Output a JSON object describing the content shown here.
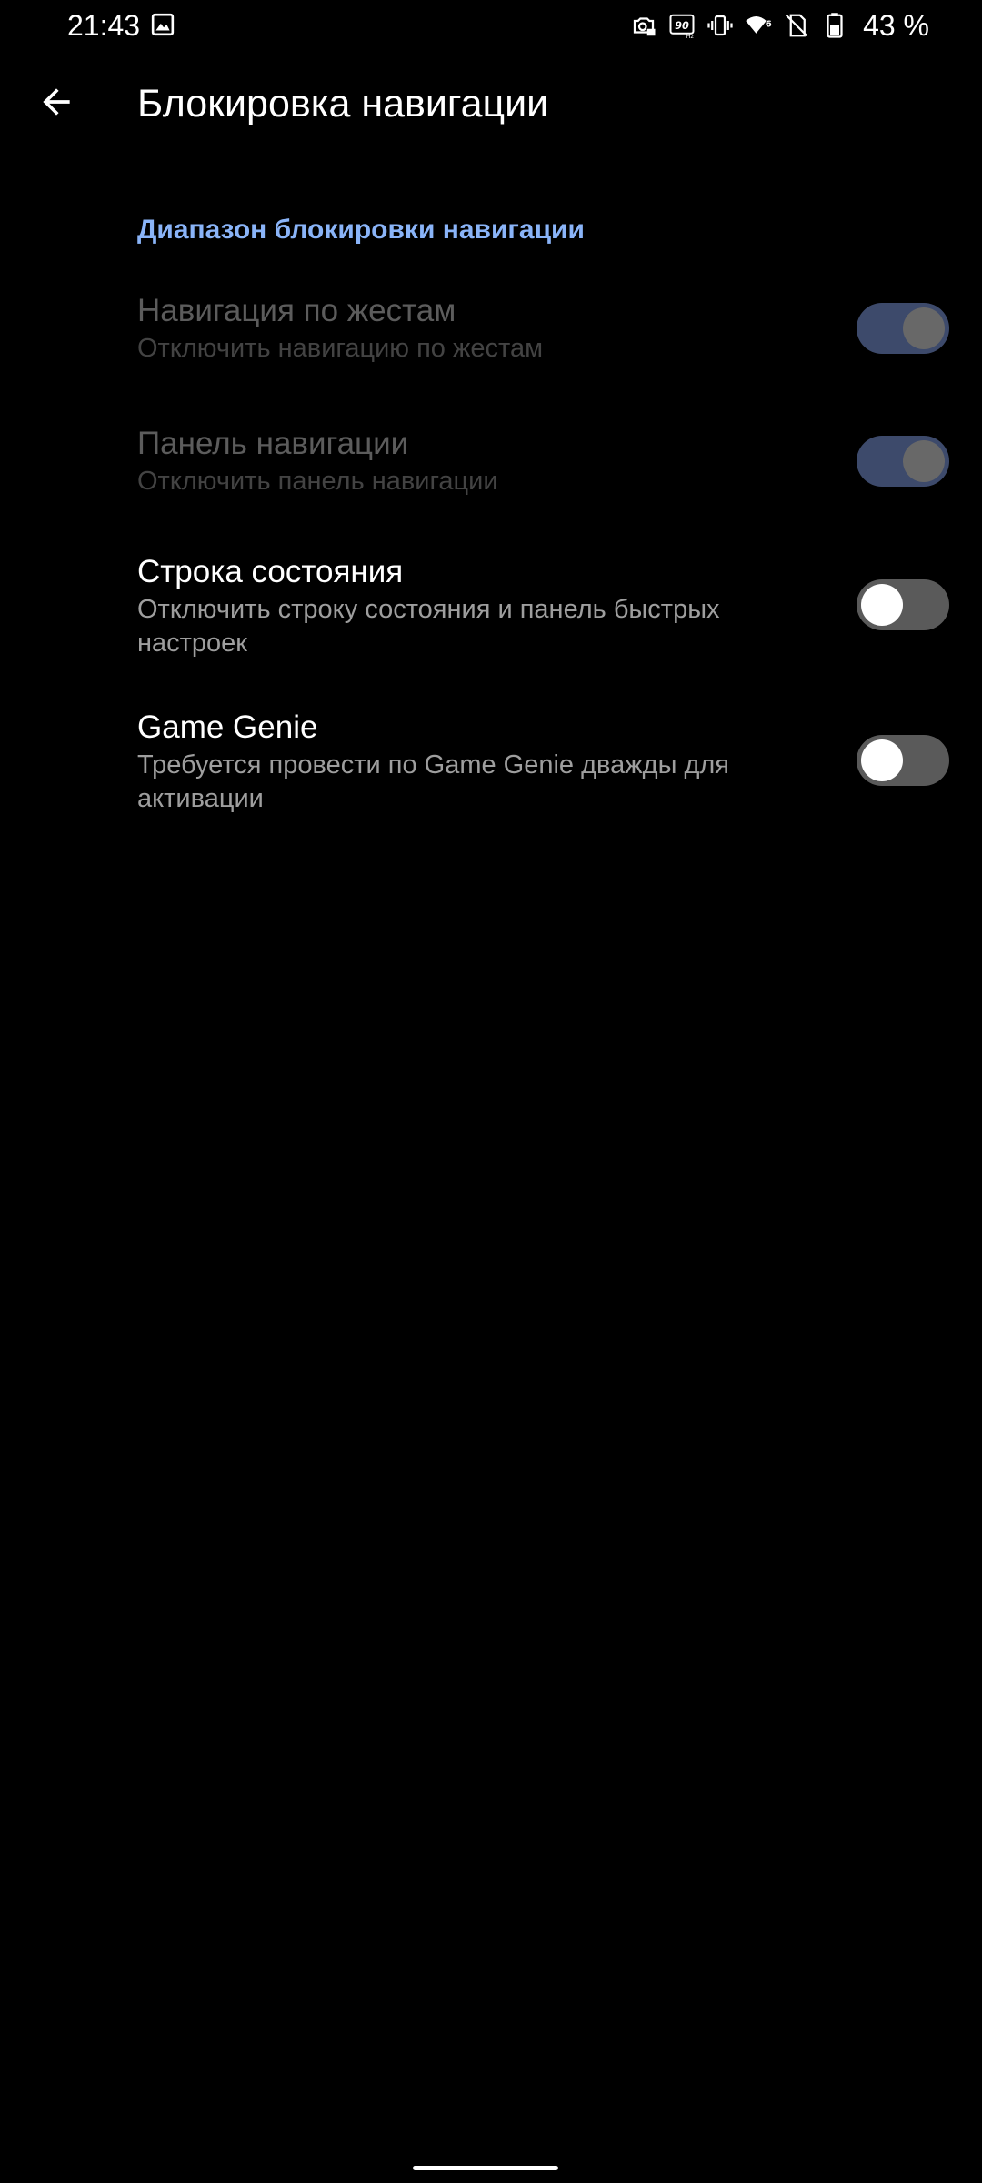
{
  "status_bar": {
    "time": "21:43",
    "battery_text": "43 %",
    "icons": [
      "gallery-icon",
      "screenshot-lock-icon",
      "refresh-rate-90hz-icon",
      "vibrate-icon",
      "wifi-6-icon",
      "no-sim-icon",
      "battery-icon"
    ]
  },
  "app_bar": {
    "back_icon": "arrow-back-icon",
    "title": "Блокировка навигации"
  },
  "section": {
    "header": "Диапазон блокировки навигации"
  },
  "settings": [
    {
      "title": "Навигация по жестам",
      "summary": "Отключить навигацию по жестам",
      "enabled": false,
      "checked": true
    },
    {
      "title": "Панель навигации",
      "summary": "Отключить панель навигации",
      "enabled": false,
      "checked": true
    },
    {
      "title": "Строка состояния",
      "summary": "Отключить строку состояния и панель быстрых настроек",
      "enabled": true,
      "checked": false
    },
    {
      "title": "Game Genie",
      "summary": "Требуется провести по Game Genie дважды для активации",
      "enabled": true,
      "checked": false
    }
  ],
  "colors": {
    "background": "#000000",
    "accent": "#8ab4f8",
    "toggle_track_off": "#5a5a5a",
    "toggle_track_disabled_on": "#3d4a6b"
  }
}
